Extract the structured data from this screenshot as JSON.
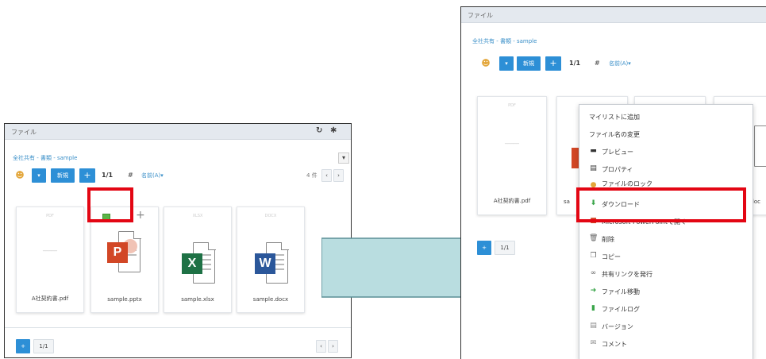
{
  "left": {
    "title": "ファイル",
    "breadcrumb": "全社共有 - 書類 - sample",
    "toolbar": {
      "new_label": "新規",
      "page": "1/1",
      "sort_label": "名前(A)▾",
      "count_label": "4 件"
    },
    "files": [
      {
        "name": "A社契約書.pdf",
        "type": "pdf"
      },
      {
        "name": "sample.pptx",
        "type": "pptx",
        "badge": "P"
      },
      {
        "name": "sample.xlsx",
        "type": "xlsx",
        "badge": "X"
      },
      {
        "name": "sample.docx",
        "type": "docx",
        "badge": "W"
      }
    ],
    "footer_page": "1/1"
  },
  "right": {
    "title": "ファイル",
    "breadcrumb": "全社共有 - 書類 - sample",
    "toolbar": {
      "new_label": "新規",
      "page": "1/1",
      "sort_label": "名前(A)▾"
    },
    "files": [
      {
        "name": "A社契約書.pdf"
      },
      {
        "name": "sa"
      },
      {
        "name": "doc"
      }
    ],
    "footer_page": "1/1",
    "context_menu": [
      {
        "label": "マイリストに追加",
        "icon": ""
      },
      {
        "label": "ファイル名の変更",
        "icon": ""
      },
      {
        "label": "プレビュー",
        "icon": "monitor-icon"
      },
      {
        "label": "プロパティ",
        "icon": "properties-icon"
      },
      {
        "label": "ファイルのロック",
        "icon": "lock-icon"
      },
      {
        "label": "ダウンロード",
        "icon": "download-icon"
      },
      {
        "label": "Microsoft PowerPointで開く",
        "icon": "powerpoint-icon"
      },
      {
        "label": "削除",
        "icon": "trash-icon"
      },
      {
        "label": "コピー",
        "icon": "copy-icon"
      },
      {
        "label": "共有リンクを発行",
        "icon": "link-icon"
      },
      {
        "label": "ファイル移動",
        "icon": "move-icon"
      },
      {
        "label": "ファイルログ",
        "icon": "log-icon"
      },
      {
        "label": "バージョン",
        "icon": "version-icon"
      },
      {
        "label": "コメント",
        "icon": "comment-icon"
      }
    ]
  },
  "colors": {
    "accent": "#2d8fd6",
    "highlight": "#e30613",
    "arrow_fill": "#b9dde0",
    "titlebar": "#e4e9ef"
  }
}
